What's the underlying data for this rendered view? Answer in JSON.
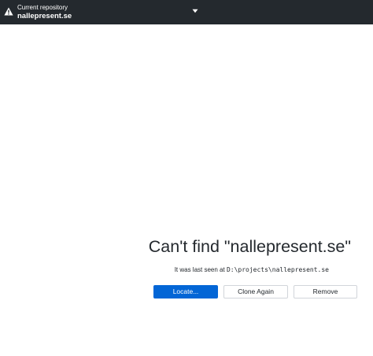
{
  "toolbar": {
    "repo_label": "Current repository",
    "repo_name": "nallepresent.se",
    "warning_icon": "warning-icon",
    "caret_icon": "caret-down-icon",
    "background_color": "#24292e"
  },
  "main": {
    "title": "Can't find \"nallepresent.se\"",
    "subtitle_prefix": "It was last seen at",
    "subtitle_path": "D:\\projects\\nallepresent.se",
    "buttons": {
      "locate": "Locate...",
      "clone_again": "Clone Again",
      "remove": "Remove"
    },
    "accent_color": "#0366d6"
  }
}
